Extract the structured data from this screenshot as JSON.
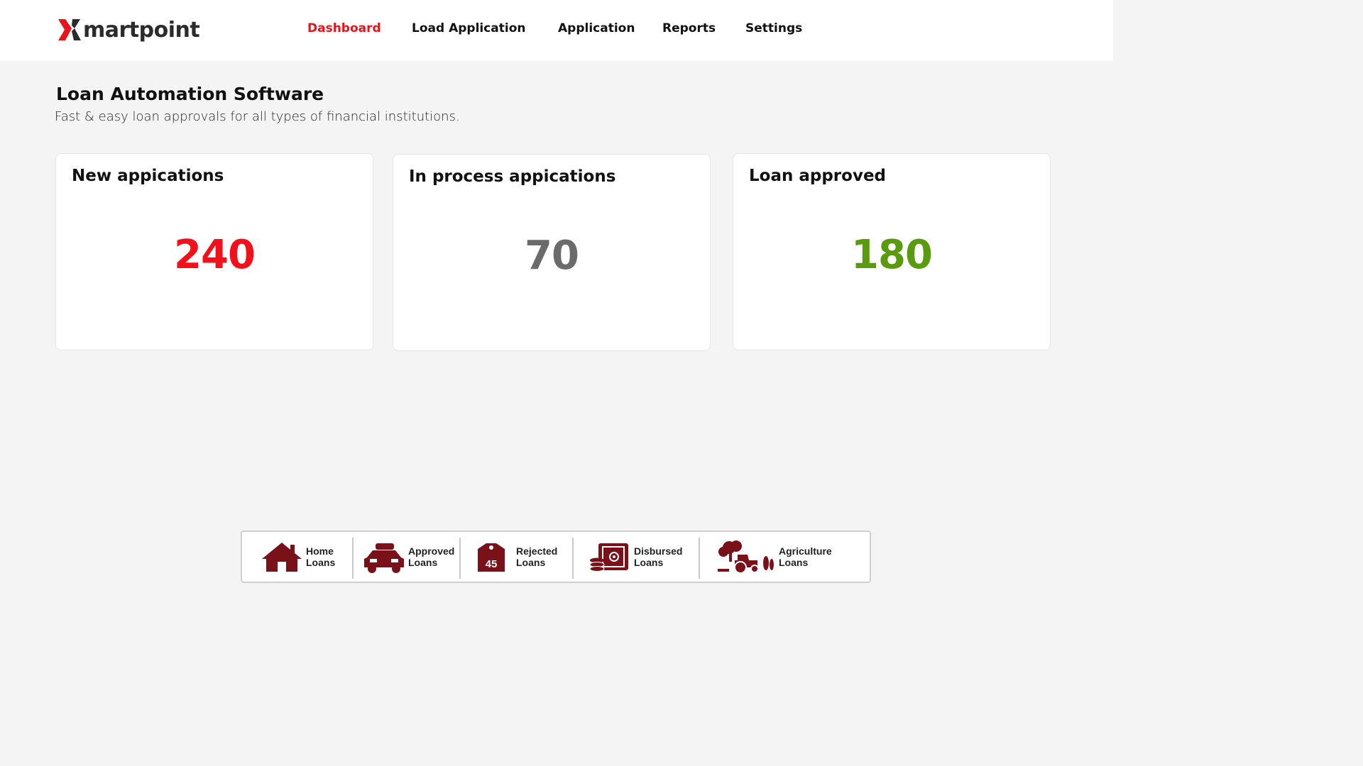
{
  "brand": {
    "logo_text": "martpoint",
    "accent_color": "#e8141b"
  },
  "nav": {
    "items": [
      {
        "label": "Dashboard",
        "active": true
      },
      {
        "label": "Load Application",
        "active": false
      },
      {
        "label": "Application",
        "active": false
      },
      {
        "label": "Reports",
        "active": false
      },
      {
        "label": "Settings",
        "active": false
      }
    ]
  },
  "header": {
    "title": "Loan Automation Software",
    "subtitle": "Fast & easy loan approvals for all types of financial institutions."
  },
  "stats": [
    {
      "title": "New appications",
      "value": "240",
      "color": "#f2101a"
    },
    {
      "title": "In process appications",
      "value": "70",
      "color": "#6b6b6b"
    },
    {
      "title": "Loan approved",
      "value": "180",
      "color": "#5a9a0e"
    }
  ],
  "loan_types": [
    {
      "label": "Home\nLoans",
      "icon": "house-icon"
    },
    {
      "label": "Approved\nLoans",
      "icon": "car-icon"
    },
    {
      "label": "Rejected\nLoans",
      "icon": "tag-icon",
      "badge": "45"
    },
    {
      "label": "Disbursed\nLoans",
      "icon": "safe-icon"
    },
    {
      "label": "Agriculture\nLoans",
      "icon": "tractor-icon"
    }
  ],
  "icon_color": "#7a1018"
}
